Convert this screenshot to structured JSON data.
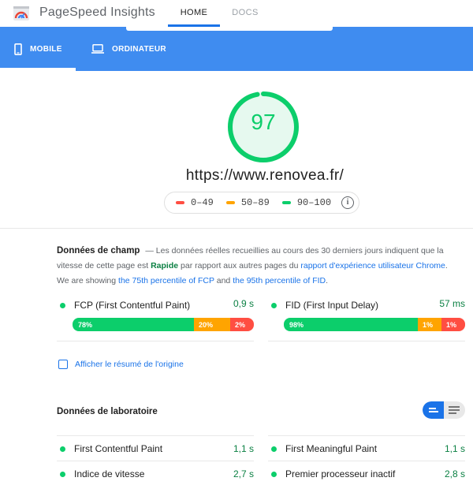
{
  "header": {
    "app_title": "PageSpeed Insights",
    "nav": [
      {
        "label": "HOME"
      },
      {
        "label": "DOCS"
      }
    ]
  },
  "device_tabs": [
    {
      "label": "MOBILE",
      "icon": "phone-icon",
      "selected": true
    },
    {
      "label": "ORDINATEUR",
      "icon": "laptop-icon",
      "selected": false
    }
  ],
  "score": {
    "value": "97",
    "value_fraction": 0.97,
    "url": "https://www.renovea.fr/",
    "legend": [
      {
        "label": "0–49",
        "color": "#ff4e42"
      },
      {
        "label": "50–89",
        "color": "#ffa400"
      },
      {
        "label": "90–100",
        "color": "#0cce6b"
      }
    ],
    "info_icon": "info-icon"
  },
  "field_data": {
    "title": "Données de champ",
    "dash": "—",
    "desc_part1": "Les données réelles recueillies au cours des 30 derniers jours indiquent que la vitesse de cette page est",
    "speed_word": "Rapide",
    "desc_part2": "par rapport aux autres pages du",
    "report_link": "rapport d'expérience utilisateur Chrome",
    "desc_part3": ". We are showing",
    "fcp_link": "the 75th percentile of FCP",
    "desc_and": "and",
    "fid_link": "the 95th percentile of FID",
    "desc_end": ".",
    "metrics": [
      {
        "name": "FCP (First Contentful Paint)",
        "value": "0,9 s",
        "distribution": [
          {
            "label": "78%",
            "pct": 78
          },
          {
            "label": "20%",
            "pct": 20
          },
          {
            "label": "2%",
            "pct": 2
          }
        ]
      },
      {
        "name": "FID (First Input Delay)",
        "value": "57 ms",
        "distribution": [
          {
            "label": "98%",
            "pct": 98
          },
          {
            "label": "1%",
            "pct": 1
          },
          {
            "label": "1%",
            "pct": 1
          }
        ]
      }
    ],
    "origin_summary_label": "Afficher le résumé de l'origine"
  },
  "lab_data": {
    "title": "Données de laboratoire",
    "metrics": [
      {
        "name": "First Contentful Paint",
        "value": "1,1 s"
      },
      {
        "name": "First Meaningful Paint",
        "value": "1,1 s"
      },
      {
        "name": "Indice de vitesse",
        "value": "2,7 s"
      },
      {
        "name": "Premier processeur inactif",
        "value": "2,8 s"
      }
    ]
  },
  "colors": {
    "accent": "#1a73e8",
    "band": "#3f8cf0",
    "fast": "#0cce6b",
    "average": "#ffa400",
    "slow": "#ff4e42"
  }
}
